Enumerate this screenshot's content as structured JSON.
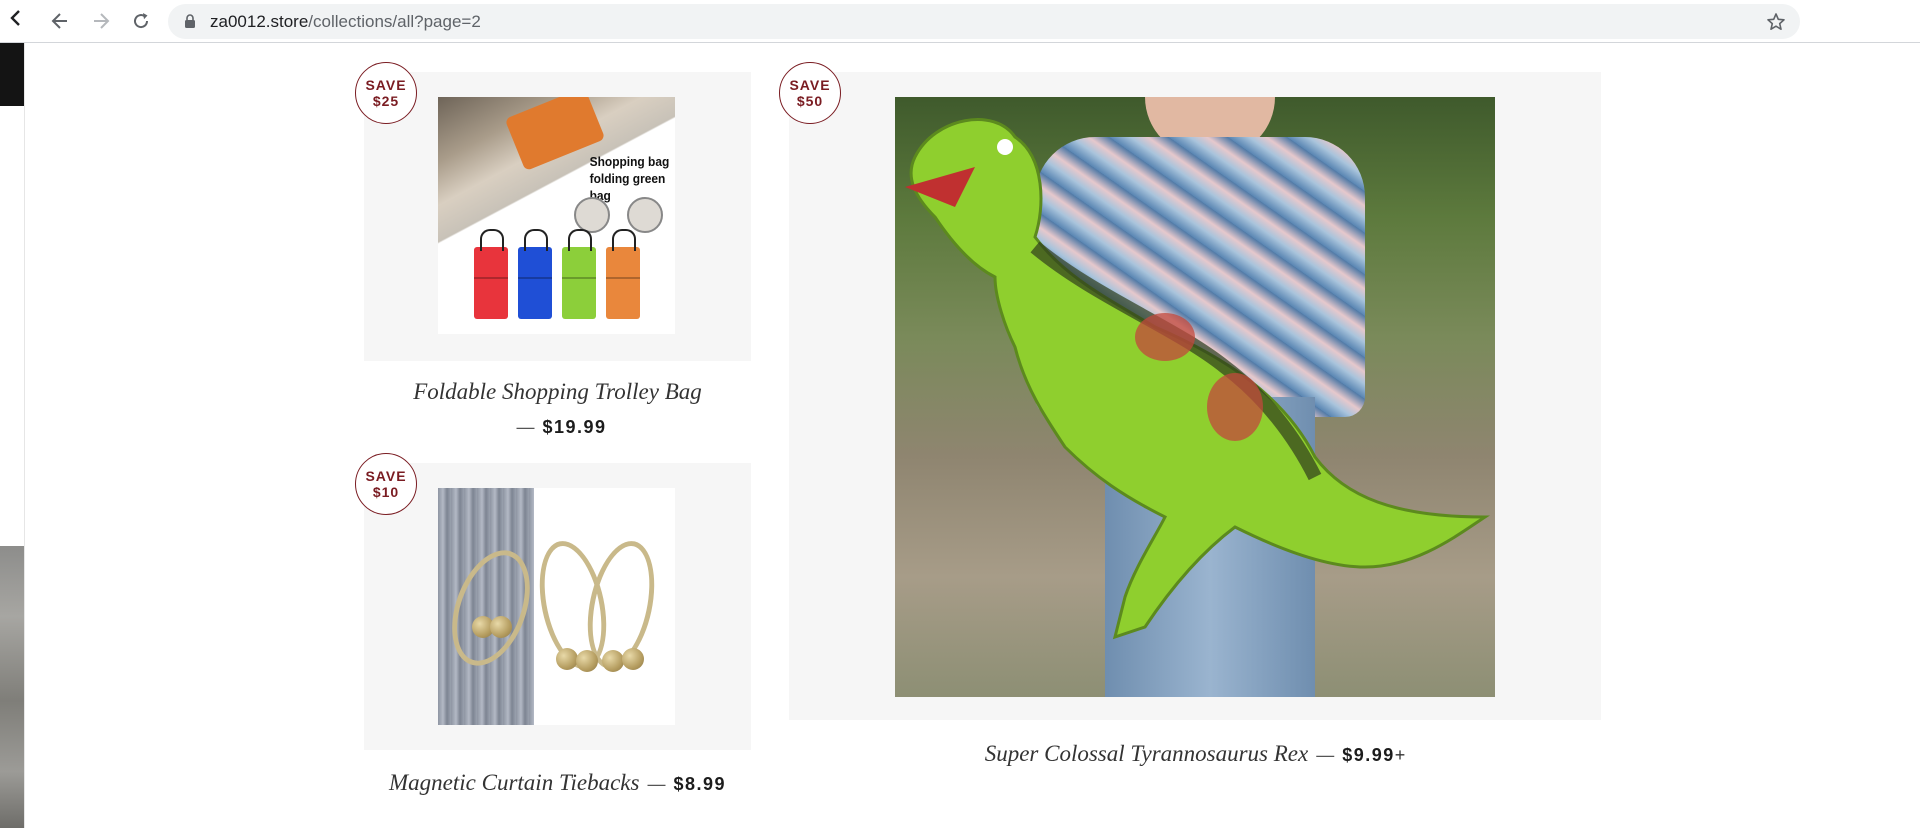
{
  "browser": {
    "url_host": "za0012.store",
    "url_path": "/collections/all?page=2"
  },
  "products": [
    {
      "title": "Foldable Shopping Trolley Bag",
      "price": "$19.99",
      "badge_line1": "SAVE",
      "badge_line2": "$25",
      "image_text_line1": "Shopping bag",
      "image_text_line2": "folding green bag",
      "bag_colors": [
        "#e8343c",
        "#1f4fd6",
        "#8ccf3a",
        "#e9873c"
      ]
    },
    {
      "title": "Magnetic Curtain Tiebacks",
      "price": "$8.99",
      "badge_line1": "SAVE",
      "badge_line2": "$10"
    },
    {
      "title": "Super Colossal Tyrannosaurus Rex",
      "price": "$9.99",
      "price_suffix": "+",
      "badge_line1": "SAVE",
      "badge_line2": "$50"
    }
  ],
  "separator": "—",
  "colors": {
    "badge": "#7a1c22",
    "card_bg": "#f6f6f6"
  }
}
